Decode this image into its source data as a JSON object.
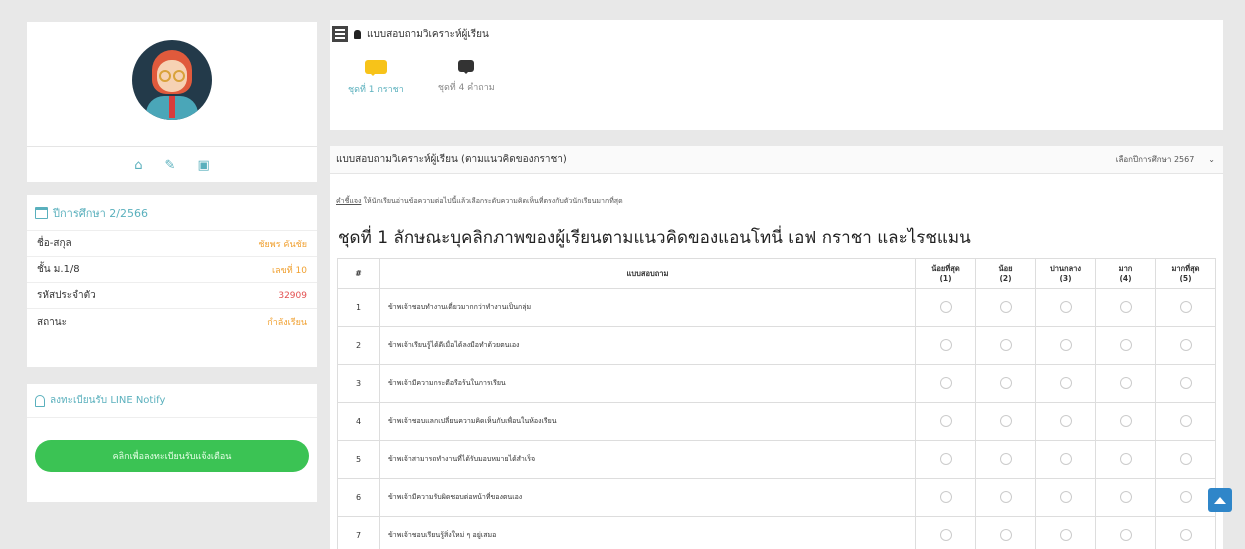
{
  "sidebar": {
    "profile_icons": [
      "home-icon",
      "edit-icon",
      "id-card-icon"
    ],
    "term_label": "ปีการศึกษา 2/2566",
    "info": [
      {
        "label": "ชื่อ-สกุล",
        "value": "ชัยพร คันชัย"
      },
      {
        "label": "ชั้น ม.1/8",
        "value": "เลขที่ 10"
      },
      {
        "label": "รหัสประจำตัว",
        "value": "32909"
      },
      {
        "label": "สถานะ",
        "value": "กำลังเรียน"
      }
    ],
    "notify_label": "ลงทะเบียนรับ LINE Notify",
    "notify_button": "คลิกเพื่อลงทะเบียนรับแจ้งเตือน"
  },
  "top_panel": {
    "title": "แบบสอบถามวิเคราะห์ผู้เรียน",
    "tabs": [
      {
        "label": "ชุดที่ 1 กราชา",
        "active": true
      },
      {
        "label": "ชุดที่ 4 คำถาม",
        "active": false
      }
    ]
  },
  "main_panel": {
    "title": "แบบสอบถามวิเคราะห์ผู้เรียน (ตามแนวคิดของกราชา)",
    "year_label": "เลือกปีการศึกษา",
    "year_value": "2567",
    "instruction_label": "คำชี้แจง",
    "instruction_text": "ให้นักเรียนอ่านข้อความต่อไปนี้แล้วเลือกระดับความคิดเห็นที่ตรงกับตัวนักเรียนมากที่สุด",
    "set_title": "ชุดที่ 1 ลักษณะบุคลิกภาพของผู้เรียนตามแนวคิดของแอนโทนี่ เอฟ กราชา และไรชแมน",
    "headers": {
      "num": "#",
      "question": "แบบสอบถาม",
      "scale": [
        {
          "label": "น้อยที่สุด",
          "value": "(1)"
        },
        {
          "label": "น้อย",
          "value": "(2)"
        },
        {
          "label": "ปานกลาง",
          "value": "(3)"
        },
        {
          "label": "มาก",
          "value": "(4)"
        },
        {
          "label": "มากที่สุด",
          "value": "(5)"
        }
      ]
    },
    "questions": [
      {
        "num": "1",
        "text": "ข้าพเจ้าชอบทำงานเดี่ยวมากกว่าทำงานเป็นกลุ่ม"
      },
      {
        "num": "2",
        "text": "ข้าพเจ้าเรียนรู้ได้ดีเมื่อได้ลงมือทำด้วยตนเอง"
      },
      {
        "num": "3",
        "text": "ข้าพเจ้ามีความกระตือรือร้นในการเรียน"
      },
      {
        "num": "4",
        "text": "ข้าพเจ้าชอบแลกเปลี่ยนความคิดเห็นกับเพื่อนในห้องเรียน"
      },
      {
        "num": "5",
        "text": "ข้าพเจ้าสามารถทำงานที่ได้รับมอบหมายได้สำเร็จ"
      },
      {
        "num": "6",
        "text": "ข้าพเจ้ามีความรับผิดชอบต่อหน้าที่ของตนเอง"
      },
      {
        "num": "7",
        "text": "ข้าพเจ้าชอบเรียนรู้สิ่งใหม่ ๆ อยู่เสมอ"
      }
    ]
  }
}
